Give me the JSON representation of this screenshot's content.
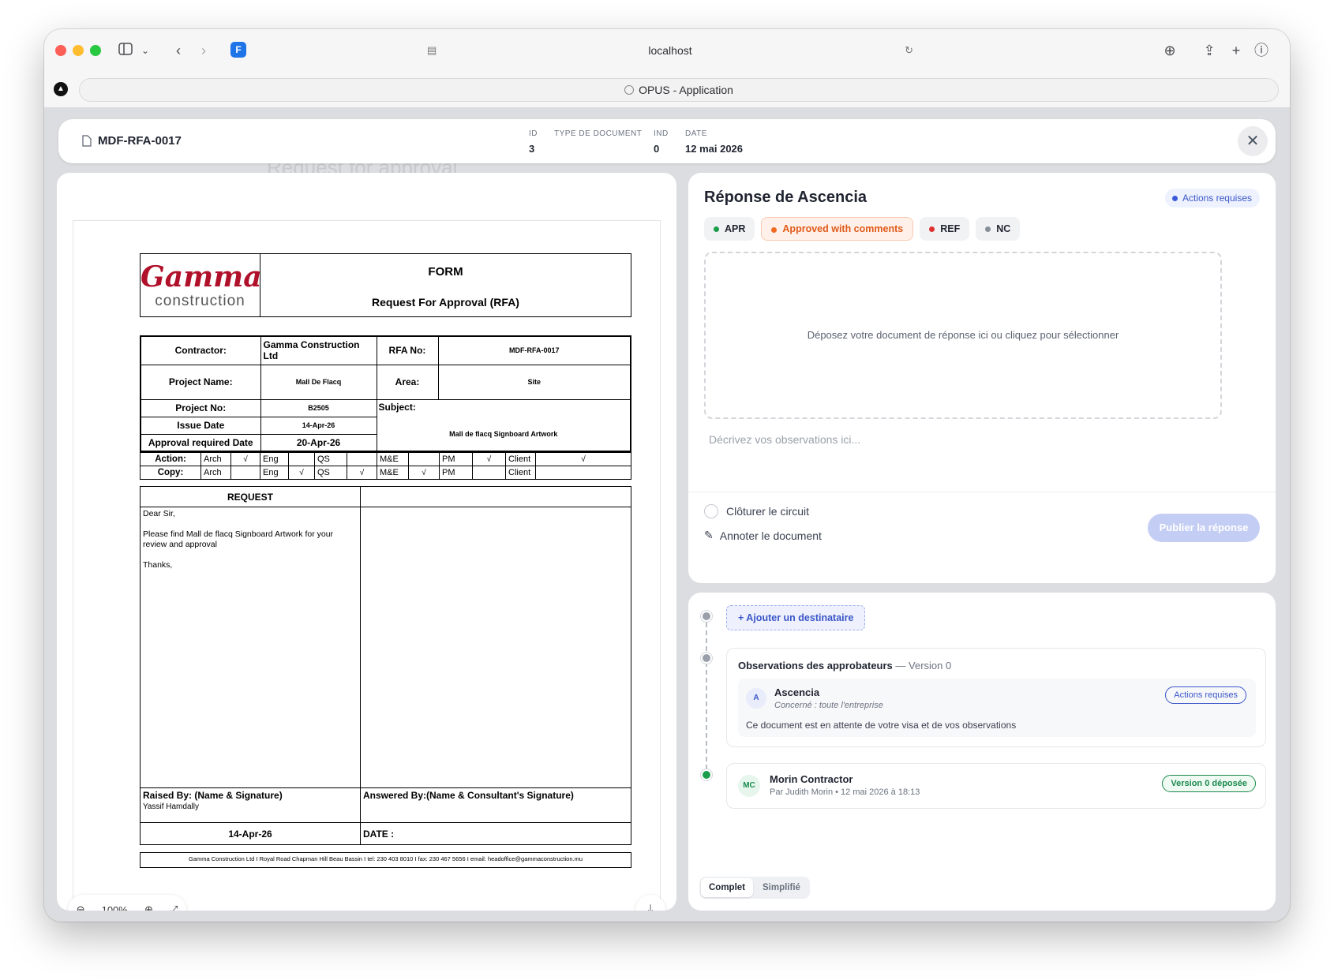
{
  "browser": {
    "url": "localhost",
    "tab_title": "OPUS - Application"
  },
  "background": {
    "ghost_title": "Request for approval"
  },
  "header": {
    "doc_code": "MDF-RFA-0017",
    "meta": [
      {
        "label": "ID",
        "value": "3"
      },
      {
        "label": "TYPE DE DOCUMENT",
        "value": ""
      },
      {
        "label": "IND",
        "value": "0"
      },
      {
        "label": "DATE",
        "value": "12 mai 2026"
      }
    ]
  },
  "document": {
    "logo_top": "Gamma",
    "logo_bottom": "construction",
    "form_title": "FORM",
    "form_subtitle": "Request For Approval (RFA)",
    "contractor_label": "Contractor:",
    "contractor_value": "Gamma Construction Ltd",
    "rfa_no_label": "RFA No:",
    "rfa_no_value": "MDF-RFA-0017",
    "project_name_label": "Project Name:",
    "project_name_value": "Mall De Flacq",
    "area_label": "Area:",
    "area_value": "Site",
    "project_no_label": "Project No:",
    "project_no_value": "B2505",
    "subject_label": "Subject:",
    "subject_value": "Mall de flacq Signboard Artwork",
    "issue_date_label": "Issue Date",
    "issue_date_value": "14-Apr-26",
    "approval_date_label": "Approval required Date",
    "approval_date_value": "20-Apr-26",
    "action_label": "Action:",
    "copy_label": "Copy:",
    "roles": [
      "Arch",
      "Eng",
      "QS",
      "M&E",
      "PM",
      "Client"
    ],
    "action_checks": [
      "√",
      "",
      "",
      "",
      "√",
      "√"
    ],
    "copy_checks": [
      "",
      "√",
      "√",
      "√",
      "",
      ""
    ],
    "request_header": "REQUEST",
    "request_salutation": "Dear Sir,",
    "request_body": "Please find Mall de flacq Signboard Artwork for your review and approval",
    "request_closing": "Thanks,",
    "raised_by_label": "Raised By: (Name & Signature)",
    "raised_by_value": "Yassif Hamdally",
    "answered_by_label": "Answered By:(Name & Consultant's Signature)",
    "raised_date": "14-Apr-26",
    "date_label": "DATE :",
    "footer": "Gamma Construction Ltd I Royal Road Chapman Hill Beau Bassin I tel: 230 403 8010 I fax: 230 467 5656 I  email: headoffice@gammaconstruction.mu"
  },
  "viewer": {
    "zoom": "100%"
  },
  "response": {
    "title": "Réponse de Ascencia",
    "status_badge": "Actions requises",
    "options": [
      {
        "label": "APR",
        "color": "#1b9e4b"
      },
      {
        "label": "Approved with comments",
        "color": "#f06a24"
      },
      {
        "label": "REF",
        "color": "#e03131"
      },
      {
        "label": "NC",
        "color": "#868e96"
      }
    ],
    "dropzone_text": "Déposez votre document de réponse ici ou cliquez pour sélectionner",
    "observations_placeholder": "Décrivez vos observations ici...",
    "close_circuit_label": "Clôturer le circuit",
    "annotate_label": "Annoter le document",
    "publish_label": "Publier la réponse"
  },
  "timeline": {
    "add_recipient_label": "+ Ajouter un destinataire",
    "observations_title": "Observations des approbateurs",
    "observations_version": " — Version 0",
    "approver": {
      "initial": "A",
      "name": "Ascencia",
      "scope": "Concerné : toute l'entreprise",
      "status": "Actions requises",
      "message": "Ce document est en attente de votre visa et de vos observations"
    },
    "submission": {
      "initials": "MC",
      "name": "Morin Contractor",
      "detail": "Par Judith Morin • 12 mai 2026 à 18:13",
      "status": "Version 0 déposée"
    },
    "view_modes": [
      "Complet",
      "Simplifié"
    ]
  }
}
